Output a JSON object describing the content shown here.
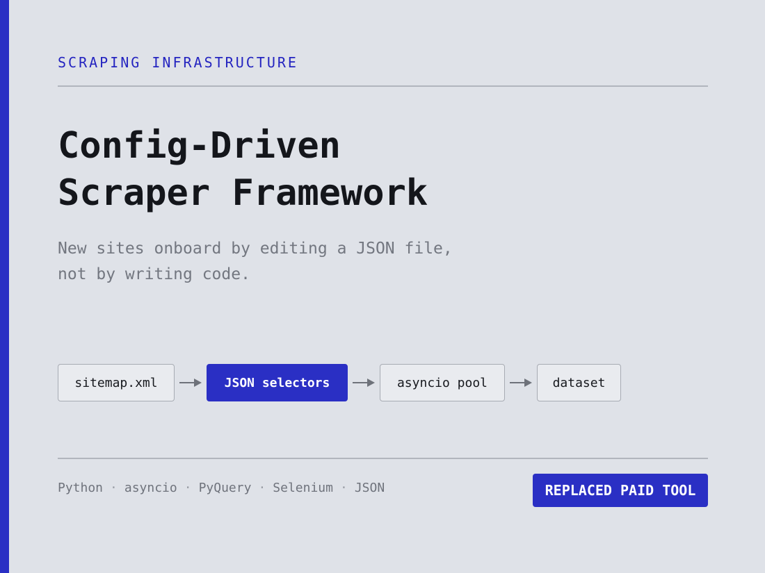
{
  "kicker": "SCRAPING INFRASTRUCTURE",
  "title": {
    "line1": "Config-Driven",
    "line2": "Scraper Framework"
  },
  "subtitle": {
    "line1": "New sites onboard by editing a JSON file,",
    "line2": "not by writing code."
  },
  "pipeline": {
    "steps": [
      {
        "label": "sitemap.xml",
        "highlighted": false
      },
      {
        "label": "JSON selectors",
        "highlighted": true
      },
      {
        "label": "asyncio pool",
        "highlighted": false
      },
      {
        "label": "dataset",
        "highlighted": false
      }
    ]
  },
  "tech_stack": [
    "Python",
    "asyncio",
    "PyQuery",
    "Selenium",
    "JSON"
  ],
  "tech_separator": "·",
  "badge": "REPLACED PAID TOOL",
  "colors": {
    "accent": "#2a2fc4",
    "background": "#dfe2e8",
    "title": "#14161b",
    "muted": "#737780"
  }
}
